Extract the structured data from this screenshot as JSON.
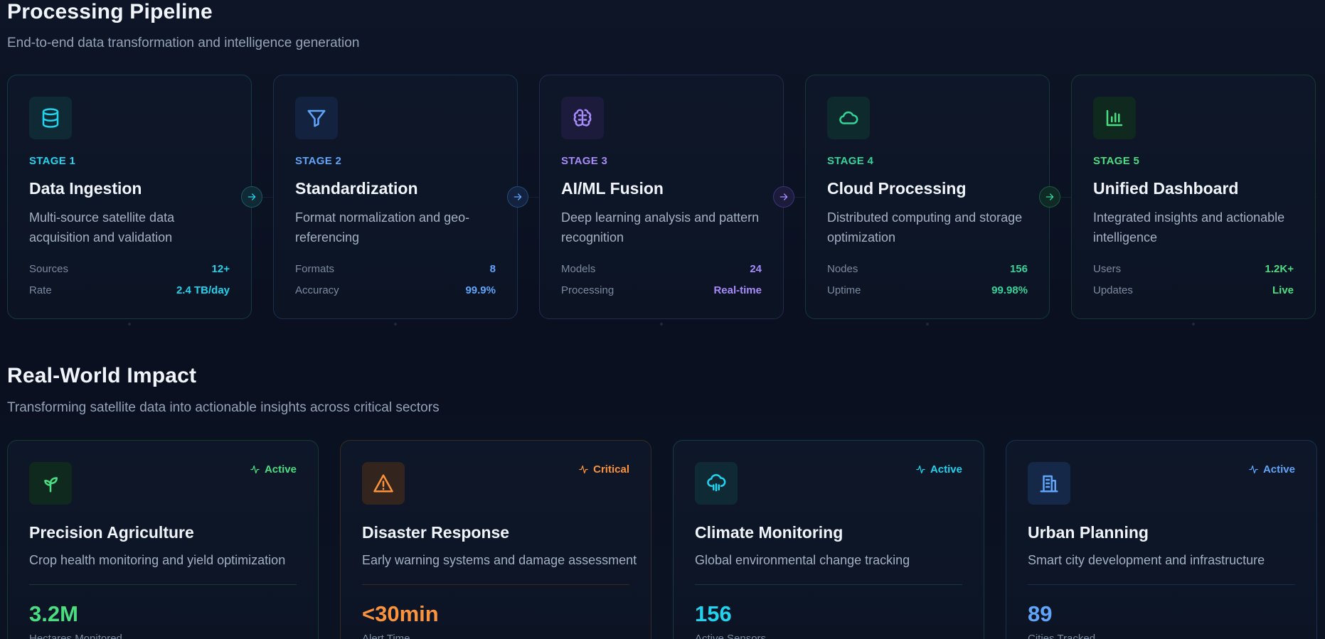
{
  "pipeline": {
    "title": "Processing Pipeline",
    "subtitle": "End-to-end data transformation and intelligence generation",
    "stages": [
      {
        "label": "STAGE 1",
        "name": "Data Ingestion",
        "desc": "Multi-source satellite data acquisition and validation",
        "icon": "database-icon",
        "color": "#22d3ee",
        "metrics": [
          {
            "label": "Sources",
            "value": "12+"
          },
          {
            "label": "Rate",
            "value": "2.4 TB/day"
          }
        ]
      },
      {
        "label": "STAGE 2",
        "name": "Standardization",
        "desc": "Format normalization and geo-referencing",
        "icon": "filter-icon",
        "color": "#60a5fa",
        "metrics": [
          {
            "label": "Formats",
            "value": "8"
          },
          {
            "label": "Accuracy",
            "value": "99.9%"
          }
        ]
      },
      {
        "label": "STAGE 3",
        "name": "AI/ML Fusion",
        "desc": "Deep learning analysis and pattern recognition",
        "icon": "brain-icon",
        "color": "#a78bfa",
        "metrics": [
          {
            "label": "Models",
            "value": "24"
          },
          {
            "label": "Processing",
            "value": "Real-time"
          }
        ]
      },
      {
        "label": "STAGE 4",
        "name": "Cloud Processing",
        "desc": "Distributed computing and storage optimization",
        "icon": "cloud-icon",
        "color": "#34d399",
        "metrics": [
          {
            "label": "Nodes",
            "value": "156"
          },
          {
            "label": "Uptime",
            "value": "99.98%"
          }
        ]
      },
      {
        "label": "STAGE 5",
        "name": "Unified Dashboard",
        "desc": "Integrated insights and actionable intelligence",
        "icon": "bar-chart-icon",
        "color": "#4ade80",
        "metrics": [
          {
            "label": "Users",
            "value": "1.2K+"
          },
          {
            "label": "Updates",
            "value": "Live"
          }
        ]
      }
    ]
  },
  "impact": {
    "title": "Real-World Impact",
    "subtitle": "Transforming satellite data into actionable insights across critical sectors",
    "cards": [
      {
        "name": "Precision Agriculture",
        "desc": "Crop health monitoring and yield optimization",
        "status": "Active",
        "value": "3.2M",
        "value_label": "Hectares Monitored",
        "icon": "sprout-icon",
        "color": "#4ade80"
      },
      {
        "name": "Disaster Response",
        "desc": "Early warning systems and damage assessment",
        "status": "Critical",
        "value": "<30min",
        "value_label": "Alert Time",
        "icon": "warning-icon",
        "color": "#fb923c"
      },
      {
        "name": "Climate Monitoring",
        "desc": "Global environmental change tracking",
        "status": "Active",
        "value": "156",
        "value_label": "Active Sensors",
        "icon": "cloud-rain-icon",
        "color": "#22d3ee"
      },
      {
        "name": "Urban Planning",
        "desc": "Smart city development and infrastructure",
        "status": "Active",
        "value": "89",
        "value_label": "Cities Tracked",
        "icon": "building-icon",
        "color": "#60a5fa"
      }
    ]
  }
}
